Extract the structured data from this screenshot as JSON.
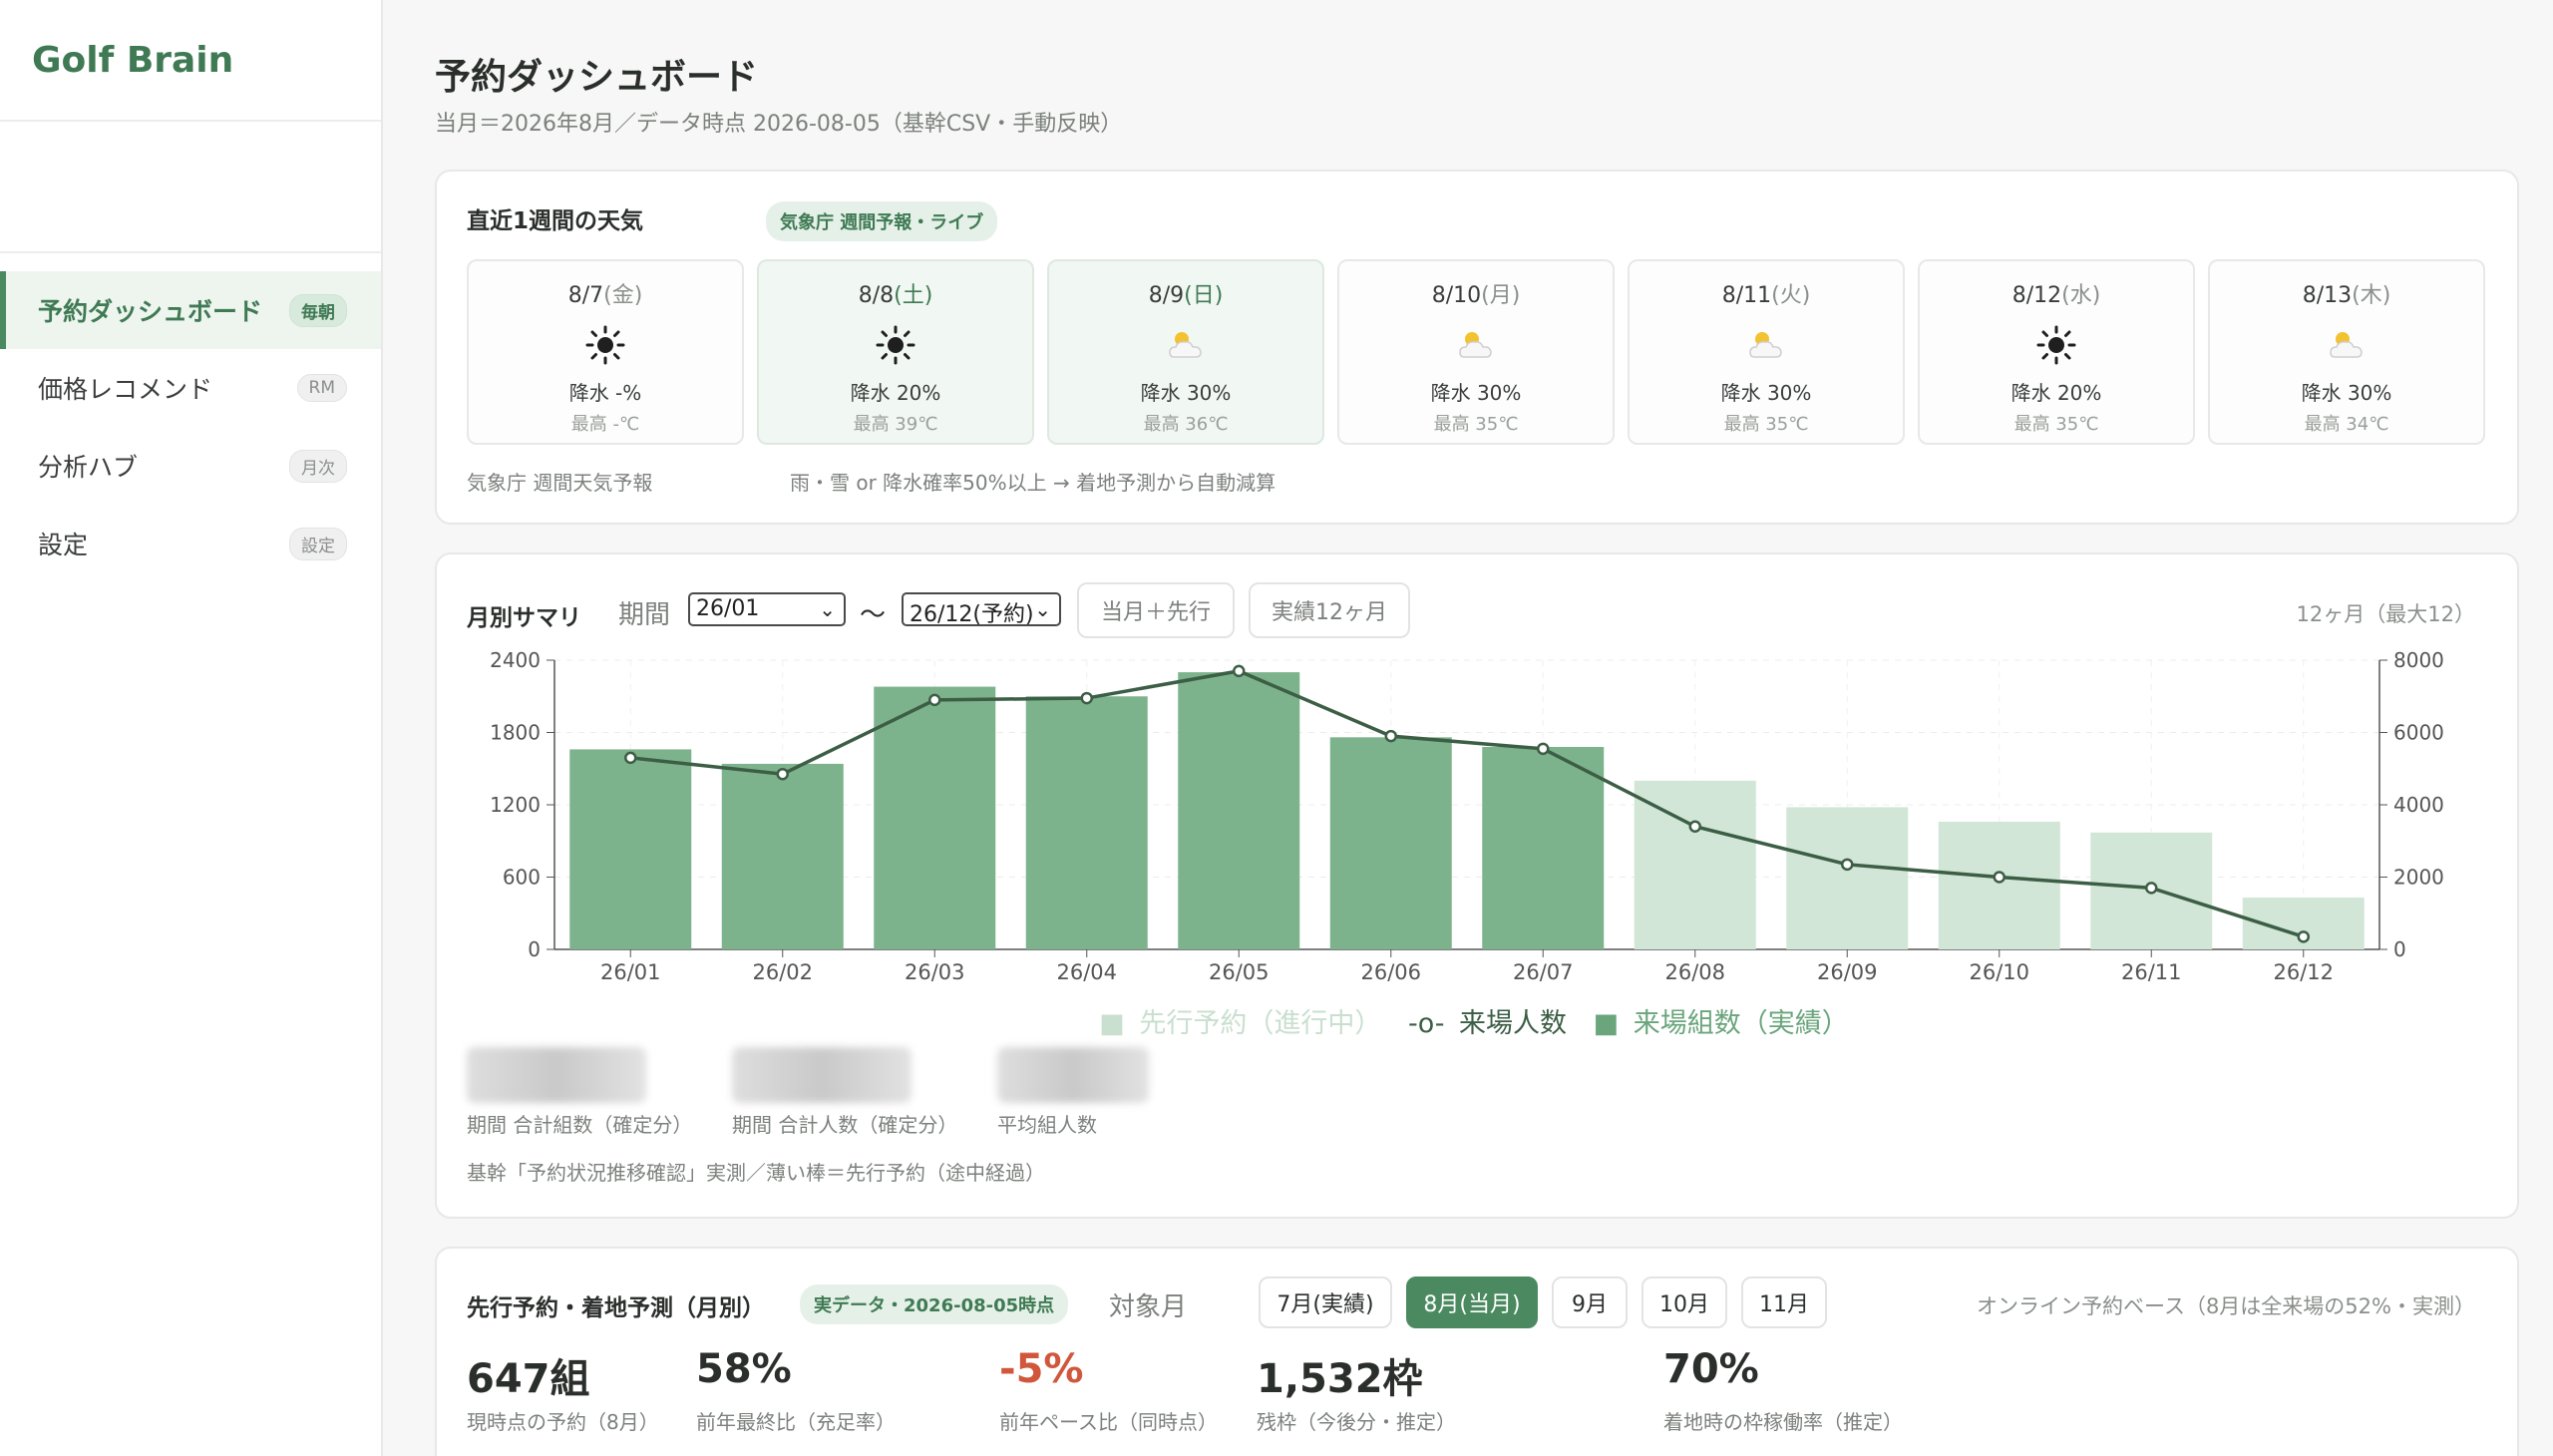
{
  "app": {
    "brand": "Golf Brain"
  },
  "sidebar": {
    "items": [
      {
        "label": "予約ダッシュボード",
        "badge": "毎朝",
        "active": true
      },
      {
        "label": "価格レコメンド",
        "badge": "RM"
      },
      {
        "label": "分析ハブ",
        "badge": "月次"
      },
      {
        "label": "設定",
        "badge": "設定"
      }
    ]
  },
  "header": {
    "title": "予約ダッシュボード",
    "subtitle": "当月＝2026年8月／データ時点 2026-08-05（基幹CSV・手動反映）"
  },
  "weather": {
    "title": "直近1週間の天気",
    "tag": "気象庁 週間予報・ライブ",
    "days": [
      {
        "date": "8/7",
        "weekday": "(金)",
        "icon": "sun-icon",
        "rain": "降水 -%",
        "max": "最高 -℃",
        "weekend": false
      },
      {
        "date": "8/8",
        "weekday": "(土)",
        "icon": "sun-icon",
        "rain": "降水 20%",
        "max": "最高 39℃",
        "weekend": true
      },
      {
        "date": "8/9",
        "weekday": "(日)",
        "icon": "sun-cloud-icon",
        "rain": "降水 30%",
        "max": "最高 36℃",
        "weekend": true
      },
      {
        "date": "8/10",
        "weekday": "(月)",
        "icon": "sun-cloud-icon",
        "rain": "降水 30%",
        "max": "最高 35℃",
        "weekend": false
      },
      {
        "date": "8/11",
        "weekday": "(火)",
        "icon": "sun-cloud-icon",
        "rain": "降水 30%",
        "max": "最高 35℃",
        "weekend": false
      },
      {
        "date": "8/12",
        "weekday": "(水)",
        "icon": "sun-icon",
        "rain": "降水 20%",
        "max": "最高 35℃",
        "weekend": false
      },
      {
        "date": "8/13",
        "weekday": "(木)",
        "icon": "sun-cloud-icon",
        "rain": "降水 30%",
        "max": "最高 34℃",
        "weekend": false
      }
    ],
    "source_note": "気象庁 週間天気予報",
    "rule_note": "雨・雪 or 降水確率50%以上 → 着地予測から自動減算"
  },
  "monthly": {
    "title": "月別サマリ",
    "period_label": "期間",
    "from_value": "26/01",
    "tilde": "〜",
    "to_value": "26/12(予約)",
    "btn_current": "当月＋先行",
    "btn_actual": "実績12ヶ月",
    "range_note": "12ヶ月（最大12）",
    "kpi_labels": [
      "期間 合計組数（確定分）",
      "期間 合計人数（確定分）",
      "平均組人数"
    ],
    "footnote": "基幹「予約状況推移確認」実測／薄い棒＝先行予約（途中経過）"
  },
  "legend": {
    "pre": "先行予約（進行中）",
    "line": "来場人数",
    "bar": "来場組数（実績）"
  },
  "chart_data": {
    "type": "bar",
    "categories": [
      "26/01",
      "26/02",
      "26/03",
      "26/04",
      "26/05",
      "26/06",
      "26/07",
      "26/08",
      "26/09",
      "26/10",
      "26/11",
      "26/12"
    ],
    "series": [
      {
        "name": "来場組数（実績）",
        "axis": "left",
        "values": [
          1660,
          1540,
          2180,
          2100,
          2300,
          1760,
          1680,
          null,
          null,
          null,
          null,
          null
        ]
      },
      {
        "name": "先行予約（進行中）",
        "axis": "left",
        "values": [
          null,
          null,
          null,
          null,
          null,
          null,
          null,
          1400,
          1180,
          1060,
          970,
          430
        ]
      },
      {
        "name": "来場人数",
        "axis": "right",
        "type": "line",
        "values": [
          5300,
          4850,
          6900,
          6950,
          7700,
          5900,
          5550,
          3400,
          2350,
          2000,
          1700,
          350
        ]
      }
    ],
    "yticks_left": [
      0,
      600,
      1200,
      1800,
      2400
    ],
    "yticks_right": [
      0,
      2000,
      4000,
      6000,
      8000
    ],
    "ylim_left": [
      0,
      2400
    ],
    "ylim_right": [
      0,
      8000
    ],
    "grid": true,
    "legend_position": "bottom",
    "colors": {
      "actual": "#7db38c",
      "pre": "#d2e6d7",
      "line": "#3c5e45"
    }
  },
  "forecast": {
    "title": "先行予約・着地予測（月別）",
    "tag": "実データ・2026-08-05時点",
    "target_label": "対象月",
    "months": [
      {
        "label": "7月(実績)",
        "active": false
      },
      {
        "label": "8月(当月)",
        "active": true
      },
      {
        "label": "9月",
        "active": false
      },
      {
        "label": "10月",
        "active": false
      },
      {
        "label": "11月",
        "active": false
      }
    ],
    "note": "オンライン予約ベース（8月は全来場の52%・実測）",
    "kpis": [
      {
        "value": "647組",
        "label": "現時点の予約（8月）"
      },
      {
        "value": "58%",
        "label": "前年最終比（充足率）"
      },
      {
        "value": "-5%",
        "label": "前年ペース比（同時点）"
      },
      {
        "value": "1,532枠",
        "label": "残枠（今後分・推定）"
      },
      {
        "value": "70%",
        "label": "着地時の枠稼働率（推定）"
      }
    ]
  }
}
